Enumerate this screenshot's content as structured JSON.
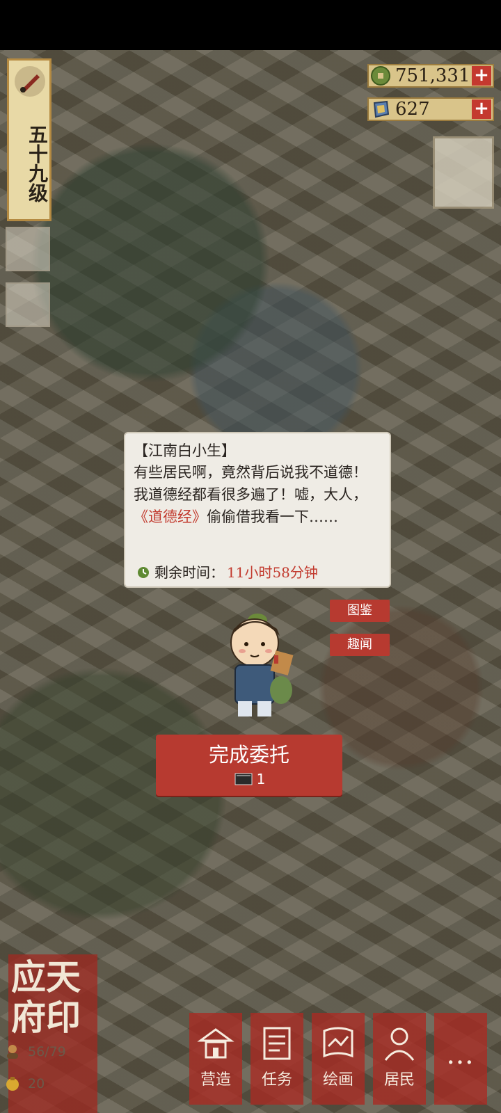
{
  "level": {
    "text": "五十九级"
  },
  "currency": {
    "coins": {
      "value": "751,331",
      "plus": "+"
    },
    "jade": {
      "value": "627",
      "plus": "+"
    }
  },
  "dialog": {
    "speaker": "【江南白小生】",
    "body_before": "有些居民啊，竟然背后说我不道德！我道德经都看很多遍了！嘘，大人，",
    "book": "《道德经》",
    "body_after": "偷偷借我看一下……",
    "timer_label": "剩余时间：",
    "timer_value": "11小时58分钟"
  },
  "tags": {
    "atlas": "图鉴",
    "anecdote": "趣闻"
  },
  "complete_button": {
    "label": "完成委托",
    "cost": "1"
  },
  "seal": {
    "text": "应天府印",
    "population": "56/79",
    "coins": "20"
  },
  "menu": [
    {
      "label": "营造",
      "icon": "build-icon"
    },
    {
      "label": "任务",
      "icon": "task-scroll-icon"
    },
    {
      "label": "绘画",
      "icon": "painting-scroll-icon"
    },
    {
      "label": "居民",
      "icon": "resident-icon"
    },
    {
      "label": "…",
      "icon": "more-icon"
    }
  ],
  "colors": {
    "accent_red": "#b73a30",
    "gold": "#d9c48a",
    "paper": "#efece5"
  }
}
